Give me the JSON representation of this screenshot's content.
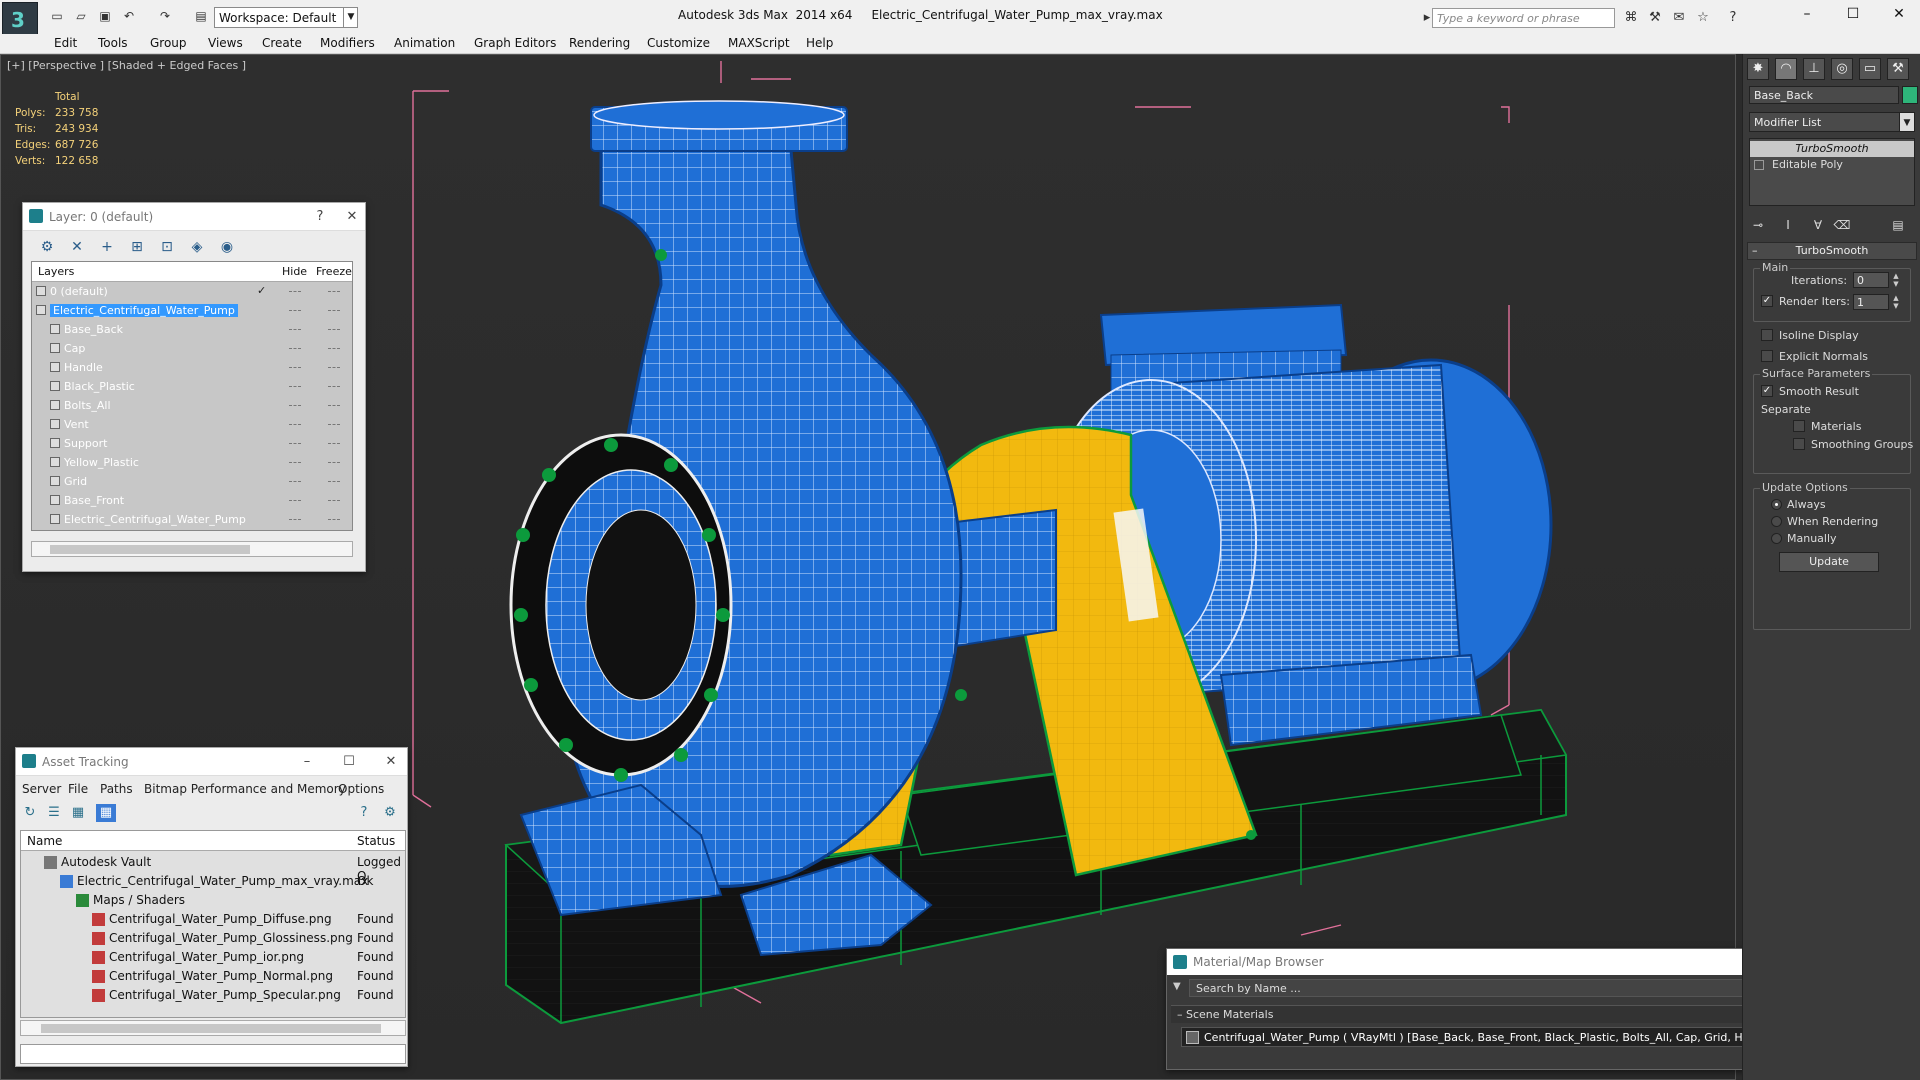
{
  "title_bar": {
    "app": "Autodesk 3ds Max  2014 x64",
    "file": "Electric_Centrifugal_Water_Pump_max_vray.max",
    "workspace": "Workspace: Default",
    "search_placeholder": "Type a keyword or phrase"
  },
  "menu": [
    "Edit",
    "Tools",
    "Group",
    "Views",
    "Create",
    "Modifiers",
    "Animation",
    "Graph Editors",
    "Rendering",
    "Customize",
    "MAXScript",
    "Help"
  ],
  "viewport": {
    "label": "[+] [Perspective ] [Shaded + Edged Faces ]",
    "stats": {
      "header": "Total",
      "rows": [
        {
          "key": "Polys:",
          "value": "233 758"
        },
        {
          "key": "Tris:",
          "value": "243 934"
        },
        {
          "key": "Edges:",
          "value": "687 726"
        },
        {
          "key": "Verts:",
          "value": "122 658"
        }
      ]
    }
  },
  "layer_panel": {
    "title": "Layer: 0 (default)",
    "help": "?",
    "columns": {
      "layers": "Layers",
      "hide": "Hide",
      "freeze": "Freeze"
    },
    "rows": [
      {
        "name": "0 (default)",
        "level": 0,
        "check": "✓"
      },
      {
        "name": "Electric_Centrifugal_Water_Pump",
        "level": 0,
        "selected": true
      },
      {
        "name": "Base_Back",
        "level": 1
      },
      {
        "name": "Cap",
        "level": 1
      },
      {
        "name": "Handle",
        "level": 1
      },
      {
        "name": "Black_Plastic",
        "level": 1
      },
      {
        "name": "Bolts_All",
        "level": 1
      },
      {
        "name": "Vent",
        "level": 1
      },
      {
        "name": "Support",
        "level": 1
      },
      {
        "name": "Yellow_Plastic",
        "level": 1
      },
      {
        "name": "Grid",
        "level": 1
      },
      {
        "name": "Base_Front",
        "level": 1
      },
      {
        "name": "Electric_Centrifugal_Water_Pump",
        "level": 1
      }
    ]
  },
  "asset_panel": {
    "title": "Asset Tracking",
    "menu": [
      "Server",
      "File",
      "Paths",
      "Bitmap Performance and Memory",
      "Options"
    ],
    "columns": {
      "name": "Name",
      "status": "Status"
    },
    "rows": [
      {
        "name": "Autodesk Vault",
        "status": "Logged O",
        "level": 0
      },
      {
        "name": "Electric_Centrifugal_Water_Pump_max_vray.max",
        "status": "Ok",
        "level": 1
      },
      {
        "name": "Maps / Shaders",
        "status": "",
        "level": 2
      },
      {
        "name": "Centrifugal_Water_Pump_Diffuse.png",
        "status": "Found",
        "level": 3
      },
      {
        "name": "Centrifugal_Water_Pump_Glossiness.png",
        "status": "Found",
        "level": 3
      },
      {
        "name": "Centrifugal_Water_Pump_ior.png",
        "status": "Found",
        "level": 3
      },
      {
        "name": "Centrifugal_Water_Pump_Normal.png",
        "status": "Found",
        "level": 3
      },
      {
        "name": "Centrifugal_Water_Pump_Specular.png",
        "status": "Found",
        "level": 3
      }
    ]
  },
  "material_browser": {
    "title": "Material/Map Browser",
    "search": "Search by Name ...",
    "section": "Scene Materials",
    "entry": "Centrifugal_Water_Pump  ( VRayMtl ) [Base_Back, Base_Front, Black_Plastic, Bolts_All, Cap, Grid, Handle, Support, Vent, Yellow_Plas..."
  },
  "command_panel": {
    "object_name": "Base_Back",
    "object_color": "#2eb57a",
    "modifier_list": "Modifier List",
    "stack": [
      "TurboSmooth",
      "Editable Poly"
    ],
    "rollout_title": "TurboSmooth",
    "main_label": "Main",
    "iterations_label": "Iterations:",
    "iterations": "0",
    "render_iters_label": "Render Iters:",
    "render_iters": "1",
    "isoline": "Isoline Display",
    "explicit_normals": "Explicit Normals",
    "surface_label": "Surface Parameters",
    "smooth_result": "Smooth Result",
    "separate_label": "Separate",
    "materials": "Materials",
    "smoothing_groups": "Smoothing Groups",
    "update_label": "Update Options",
    "always": "Always",
    "when_rendering": "When Rendering",
    "manually": "Manually",
    "update_button": "Update"
  },
  "colors": {
    "pump_blue": "#1f6fd6",
    "motor_yellow": "#f2b90f",
    "frame_green": "#0c9a3c",
    "bbox_pink": "#e0709a"
  }
}
